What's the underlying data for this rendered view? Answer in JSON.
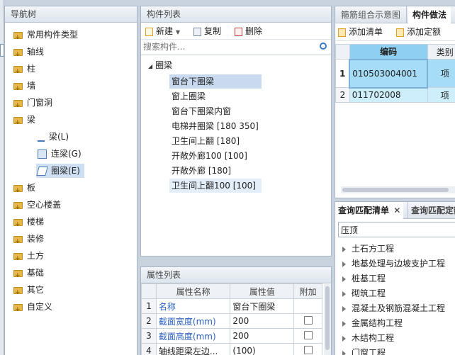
{
  "nav": {
    "title": "导航树",
    "items": [
      "常用构件类型",
      "轴线",
      "柱",
      "墙",
      "门窗洞",
      "梁",
      "板",
      "空心楼盖",
      "楼梯",
      "装修",
      "土方",
      "基础",
      "其它",
      "自定义"
    ],
    "beam_children": [
      "梁(L)",
      "连梁(G)",
      "圈梁(E)"
    ]
  },
  "components": {
    "title": "构件列表",
    "toolbar": {
      "new": "新建",
      "copy": "复制",
      "delete": "删除"
    },
    "search_placeholder": "搜索构件...",
    "root": "圈梁",
    "items": [
      "窗台下圈梁",
      "窗上圈梁",
      "窗台下圈梁内窗",
      "电梯井圈梁 [180 350]",
      "卫生间上翻 [180]",
      "开敞外廊100 [100]",
      "开敞外廊 [180]",
      "卫生间上翻100 [100]"
    ]
  },
  "properties": {
    "title": "属性列表",
    "headers": [
      "属性名称",
      "属性值",
      "附加"
    ],
    "rows": [
      {
        "num": "1",
        "name": "名称",
        "value": "窗台下圈梁"
      },
      {
        "num": "2",
        "name": "截面宽度(mm)",
        "value": "200"
      },
      {
        "num": "3",
        "name": "截面高度(mm)",
        "value": "200"
      },
      {
        "num": "4",
        "name": "轴线距梁左边...",
        "value": "(100)"
      }
    ]
  },
  "method": {
    "tabs": [
      "箍筋组合示意图",
      "构件做法"
    ],
    "toolbar": {
      "add_list": "添加清单",
      "add_quota": "添加定额"
    },
    "headers": [
      "编码",
      "类别"
    ],
    "rows": [
      {
        "num": "1",
        "code": "010503004001",
        "type": "项"
      },
      {
        "num": "2",
        "code": "011702008",
        "type": "项"
      }
    ]
  },
  "match": {
    "tabs": [
      "查询匹配清单",
      "查询匹配定额"
    ],
    "filter_value": "压顶",
    "items": [
      "土石方工程",
      "地基处理与边坡支护工程",
      "桩基工程",
      "砌筑工程",
      "混凝土及钢筋混凝土工程",
      "金属结构工程",
      "木结构工程",
      "门窗工程"
    ]
  }
}
